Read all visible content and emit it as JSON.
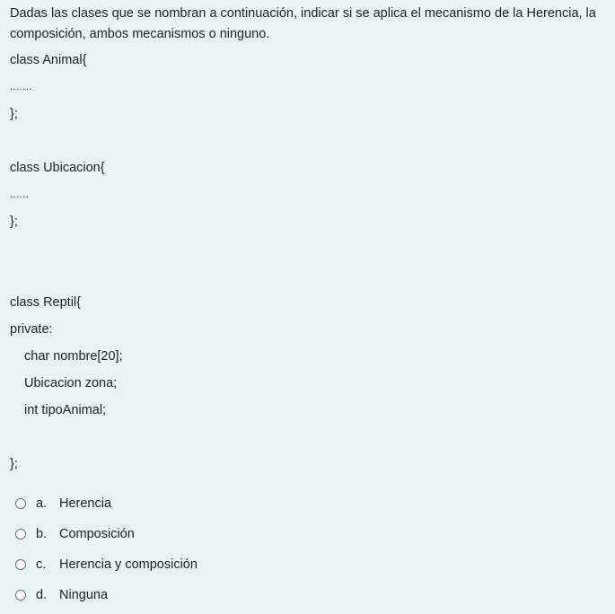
{
  "question": {
    "line1": "Dadas las clases que se nombran a continuación, indicar si se aplica el mecanismo de la Herencia, la",
    "line2": "composición, ambos mecanismos o ninguno.",
    "code": {
      "animal_open": "class Animal{",
      "animal_dots": ".......",
      "animal_close": "};",
      "ubicacion_open": "class Ubicacion{",
      "ubicacion_dots": "......",
      "ubicacion_close": "};",
      "reptil_open": "class Reptil{",
      "reptil_private": "private:",
      "reptil_field1": "char nombre[20];",
      "reptil_field2": "Ubicacion zona;",
      "reptil_field3": "int tipoAnimal;",
      "reptil_close": "};"
    }
  },
  "options": [
    {
      "letter": "a.",
      "label": "Herencia"
    },
    {
      "letter": "b.",
      "label": "Composición"
    },
    {
      "letter": "c.",
      "label": "Herencia y composición"
    },
    {
      "letter": "d.",
      "label": "Ninguna"
    }
  ]
}
